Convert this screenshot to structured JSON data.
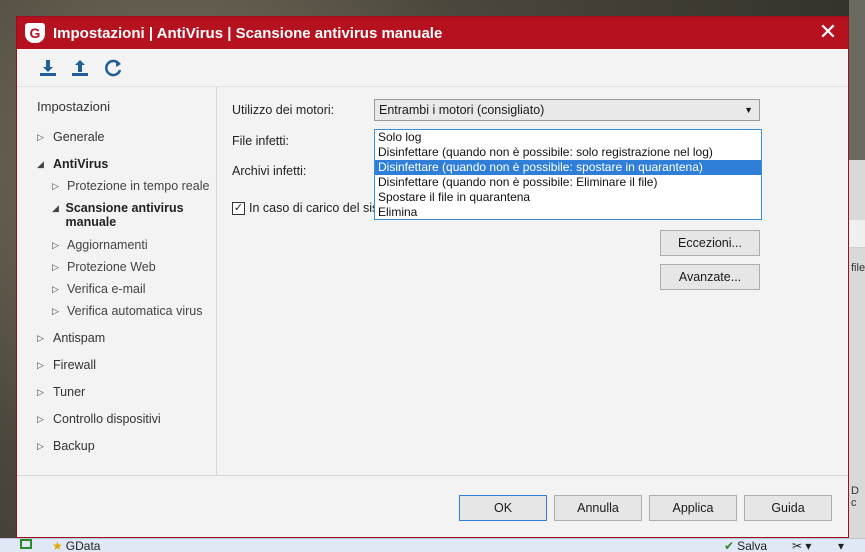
{
  "window": {
    "title": "Impostazioni | AntiVirus | Scansione antivirus manuale",
    "logo_letter": "G",
    "close_glyph": "✕"
  },
  "toolbar": {
    "icons": [
      "import-icon",
      "export-icon",
      "restore-defaults-icon"
    ]
  },
  "sidebar": {
    "header": "Impostazioni",
    "items": [
      {
        "label": "Generale"
      },
      {
        "label": "AntiVirus"
      },
      {
        "label": "Antispam"
      },
      {
        "label": "Firewall"
      },
      {
        "label": "Tuner"
      },
      {
        "label": "Controllo dispositivi"
      },
      {
        "label": "Backup"
      }
    ],
    "antivirus_children": [
      {
        "label": "Protezione in tempo reale"
      },
      {
        "label": "Scansione antivirus manuale"
      },
      {
        "label": "Aggiornamenti"
      },
      {
        "label": "Protezione Web"
      },
      {
        "label": "Verifica e-mail"
      },
      {
        "label": "Verifica automatica virus"
      }
    ]
  },
  "content": {
    "engines_label": "Utilizzo dei motori:",
    "engines_value": "Entrambi i motori (consigliato)",
    "infected_files_label": "File infetti:",
    "infected_archives_label": "Archivi infetti:",
    "dropdown_options": [
      "Solo log",
      "Disinfettare (quando non è possibile: solo registrazione nel log)",
      "Disinfettare (quando non è possibile: spostare in quarantena)",
      "Disinfettare (quando non è possibile: Eliminare il file)",
      "Spostare il file in quarantena",
      "Elimina"
    ],
    "selected_option_index": 2,
    "checkbox_label": "In caso di carico del siste",
    "checkbox_checked": true,
    "exceptions_button": "Eccezioni...",
    "advanced_button": "Avanzate..."
  },
  "footer": {
    "ok": "OK",
    "cancel": "Annulla",
    "apply": "Applica",
    "help": "Guida"
  },
  "taskbar": {
    "app_label": "GData",
    "save_label": "Salva"
  },
  "background_right": {
    "text_1": "file",
    "text_2": "D c"
  },
  "colors": {
    "title_bar": "#b5111f",
    "selection": "#2f7fd8",
    "listbox_border": "#3b8fd9"
  }
}
